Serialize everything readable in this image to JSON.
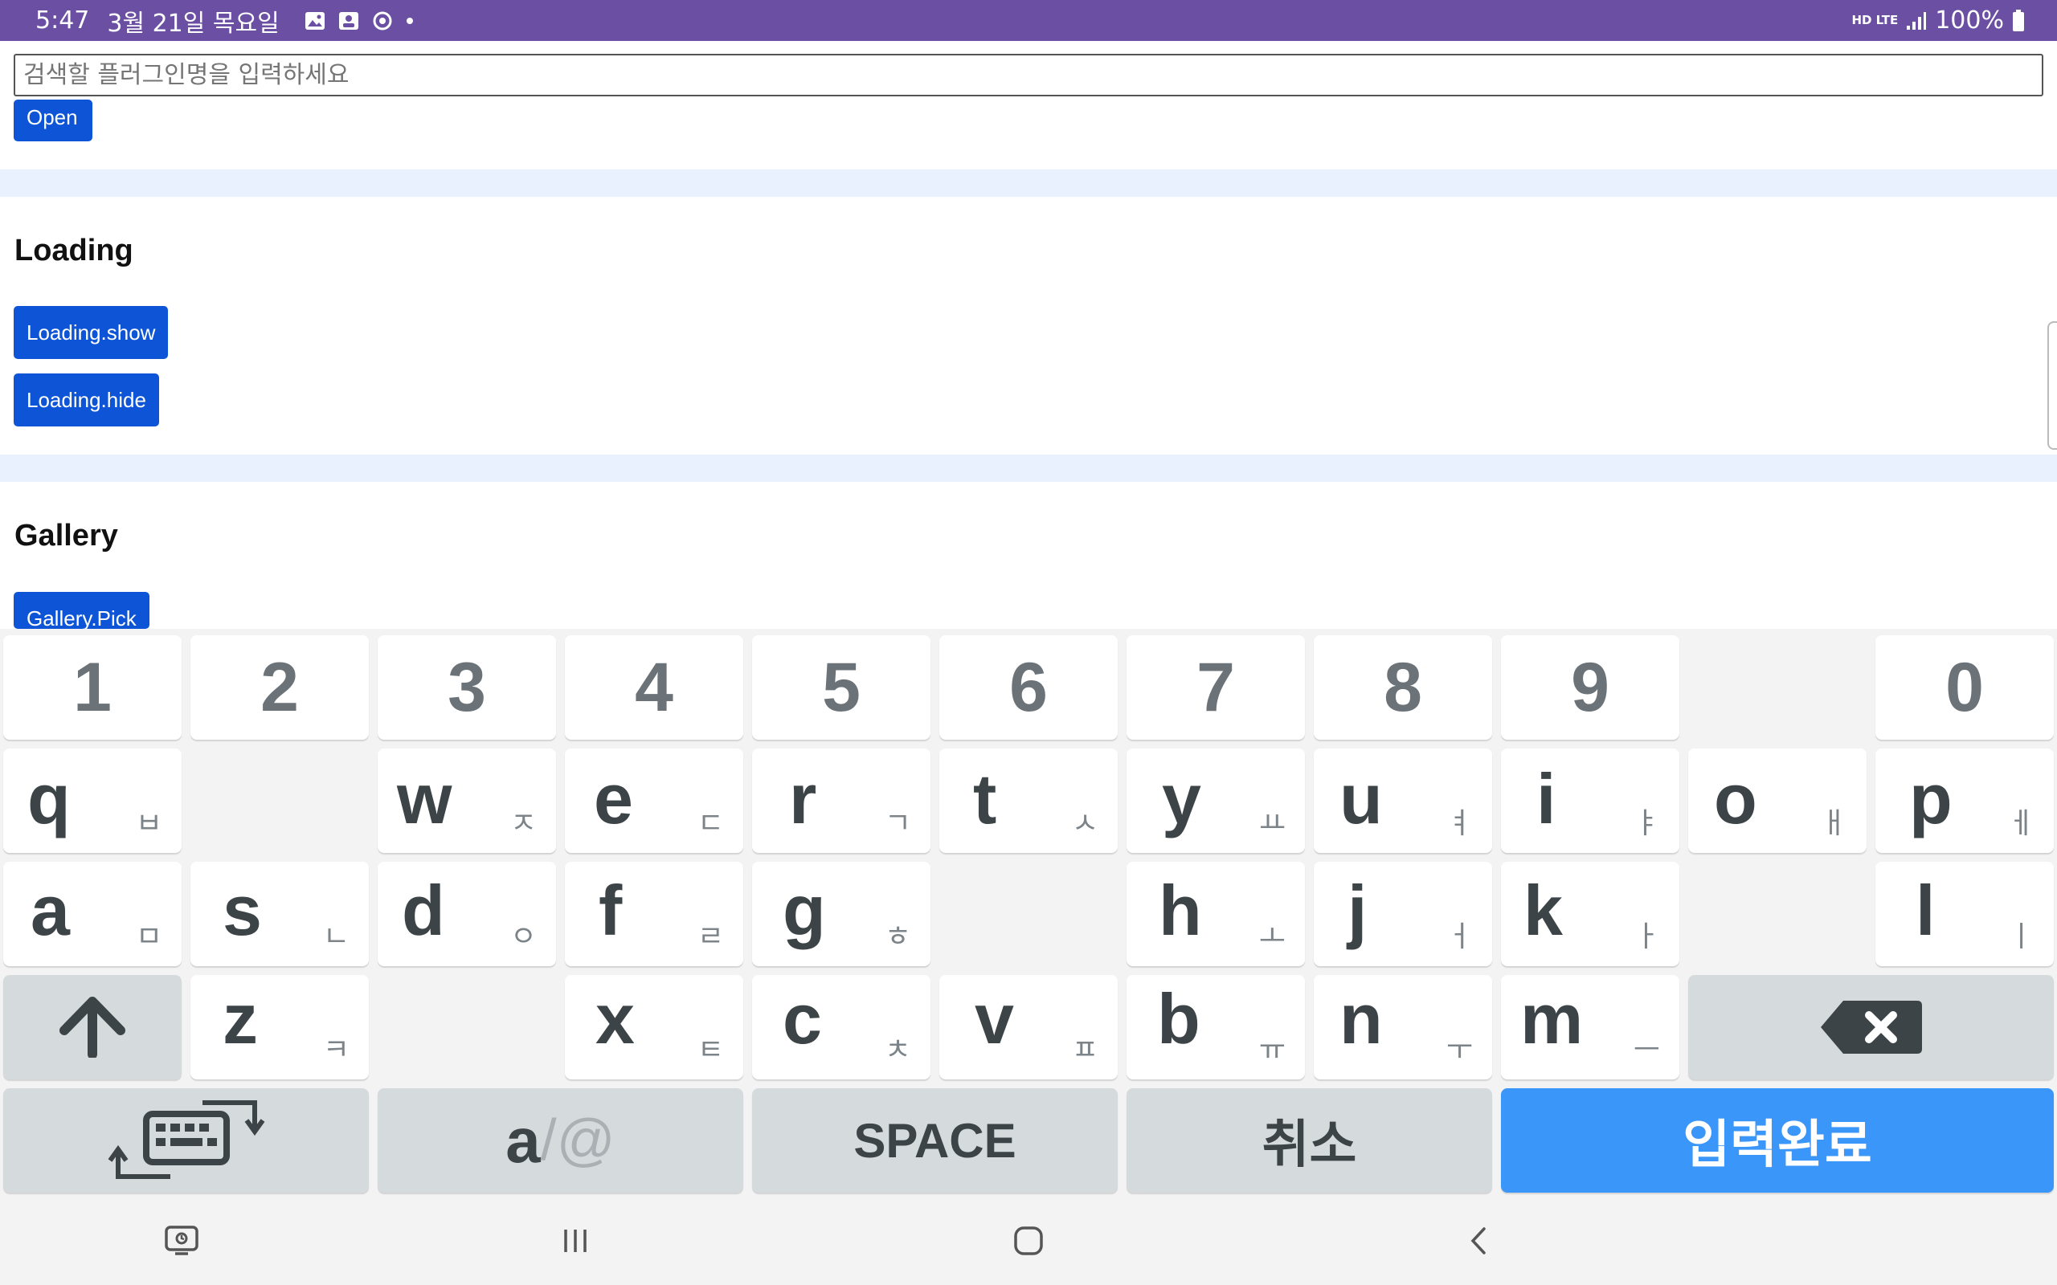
{
  "status_bar": {
    "time": "5:47",
    "date": "3월 21일 목요일",
    "notification_icons": [
      "gallery-icon",
      "contact-card-icon",
      "sync-icon",
      "dot-icon"
    ],
    "net_type_top": "HD LTE",
    "battery": "100%"
  },
  "search": {
    "placeholder": "검색할 플러그인명을 입력하세요"
  },
  "content": {
    "open_button": "Open",
    "sections": [
      {
        "title": "Loading",
        "buttons": [
          "Loading.show",
          "Loading.hide"
        ]
      },
      {
        "title": "Gallery",
        "buttons": [
          "Gallery.Pick"
        ]
      }
    ]
  },
  "keyboard": {
    "number_row": [
      "1",
      "2",
      "3",
      "4",
      "5",
      "6",
      "7",
      "8",
      "9",
      "0"
    ],
    "row1": [
      {
        "en": "q",
        "ko": "ㅂ"
      },
      {
        "en": "w",
        "ko": "ㅈ"
      },
      {
        "en": "e",
        "ko": "ㄷ"
      },
      {
        "en": "r",
        "ko": "ㄱ"
      },
      {
        "en": "t",
        "ko": "ㅅ"
      },
      {
        "en": "y",
        "ko": "ㅛ"
      },
      {
        "en": "u",
        "ko": "ㅕ"
      },
      {
        "en": "i",
        "ko": "ㅑ"
      },
      {
        "en": "o",
        "ko": "ㅐ"
      },
      {
        "en": "p",
        "ko": "ㅔ"
      }
    ],
    "row2": [
      {
        "en": "a",
        "ko": "ㅁ"
      },
      {
        "en": "s",
        "ko": "ㄴ"
      },
      {
        "en": "d",
        "ko": "ㅇ"
      },
      {
        "en": "f",
        "ko": "ㄹ"
      },
      {
        "en": "g",
        "ko": "ㅎ"
      },
      {
        "en": "h",
        "ko": "ㅗ"
      },
      {
        "en": "j",
        "ko": "ㅓ"
      },
      {
        "en": "k",
        "ko": "ㅏ"
      },
      {
        "en": "l",
        "ko": "ㅣ"
      }
    ],
    "row3": [
      {
        "en": "z",
        "ko": "ㅋ"
      },
      {
        "en": "x",
        "ko": "ㅌ"
      },
      {
        "en": "c",
        "ko": "ㅊ"
      },
      {
        "en": "v",
        "ko": "ㅍ"
      },
      {
        "en": "b",
        "ko": "ㅠ"
      },
      {
        "en": "n",
        "ko": "ㅜ"
      },
      {
        "en": "m",
        "ko": "ㅡ"
      }
    ],
    "bottom": {
      "symbol_toggle_a": "a",
      "symbol_toggle_at": "/@",
      "space": "SPACE",
      "cancel": "취소",
      "done": "입력완료"
    },
    "colors": {
      "done_key": "#3a96f8",
      "accent": "#0d55d6"
    }
  },
  "nav_bar": {
    "icons": [
      "recent-apps-lock-icon",
      "recents-icon",
      "home-icon",
      "back-icon"
    ]
  }
}
